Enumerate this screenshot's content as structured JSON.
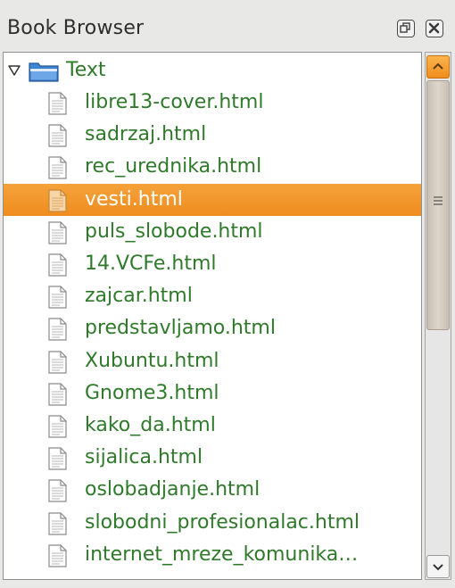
{
  "panel": {
    "title": "Book Browser",
    "float_icon": "float-icon",
    "close_icon": "close-icon"
  },
  "tree": {
    "root": {
      "label": "Text",
      "icon": "folder-icon",
      "expanded": true
    },
    "items": [
      {
        "label": "libre13-cover.html",
        "selected": false
      },
      {
        "label": "sadrzaj.html",
        "selected": false
      },
      {
        "label": "rec_urednika.html",
        "selected": false
      },
      {
        "label": "vesti.html",
        "selected": true
      },
      {
        "label": "puls_slobode.html",
        "selected": false
      },
      {
        "label": "14.VCFe.html",
        "selected": false
      },
      {
        "label": "zajcar.html",
        "selected": false
      },
      {
        "label": "predstavljamo.html",
        "selected": false
      },
      {
        "label": "Xubuntu.html",
        "selected": false
      },
      {
        "label": "Gnome3.html",
        "selected": false
      },
      {
        "label": "kako_da.html",
        "selected": false
      },
      {
        "label": "sijalica.html",
        "selected": false
      },
      {
        "label": "oslobadjanje.html",
        "selected": false
      },
      {
        "label": "slobodni_profesionalac.html",
        "selected": false
      },
      {
        "label": "internet_mreze_komunika…",
        "selected": false
      }
    ]
  },
  "colors": {
    "item_text": "#2f7a2a",
    "selection": "#ef8d1f",
    "selected_text": "#ffffff"
  }
}
